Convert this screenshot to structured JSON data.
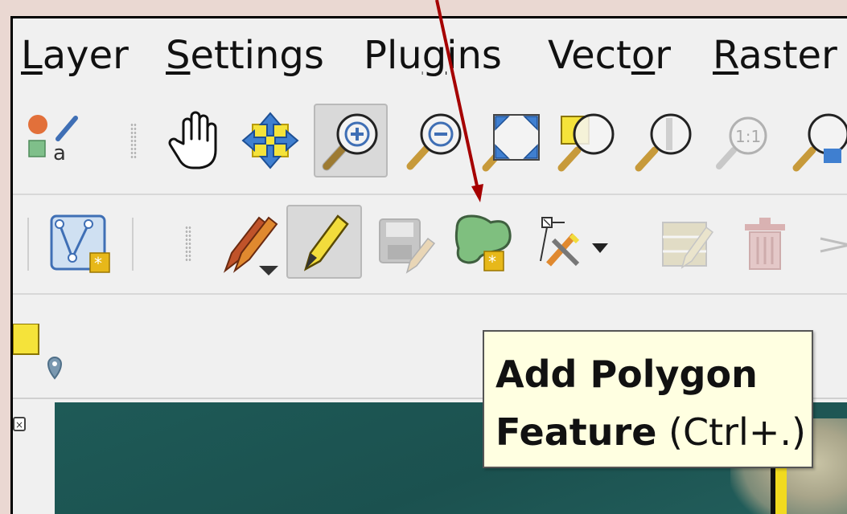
{
  "menubar": {
    "items": [
      {
        "mnemonic": "L",
        "rest": "ayer"
      },
      {
        "mnemonic": "S",
        "rest": "ettings"
      },
      {
        "pre": "Plu",
        "mnemonic": "g",
        "rest": "ins"
      },
      {
        "pre": "Vect",
        "mnemonic": "o",
        "rest": "r"
      },
      {
        "mnemonic": "R",
        "rest": "aster"
      }
    ]
  },
  "toolbar_map_nav": {
    "items": [
      {
        "icon": "layer-styling-icon",
        "label": "a"
      },
      {
        "icon": "pan-hand-icon"
      },
      {
        "icon": "pan-to-selection-icon"
      },
      {
        "icon": "zoom-in-icon",
        "active": true
      },
      {
        "icon": "zoom-out-icon"
      },
      {
        "icon": "zoom-full-icon"
      },
      {
        "icon": "zoom-to-selection-icon"
      },
      {
        "icon": "zoom-to-layer-icon"
      },
      {
        "icon": "zoom-native-resolution-icon",
        "label": "1:1"
      },
      {
        "icon": "zoom-last-icon"
      }
    ]
  },
  "toolbar_digitizing": {
    "items": [
      {
        "icon": "vertex-tool-icon"
      },
      {
        "icon": "current-edits-icon"
      },
      {
        "icon": "toggle-editing-icon",
        "active": true
      },
      {
        "icon": "save-edits-icon",
        "disabled": true
      },
      {
        "icon": "add-polygon-feature-icon"
      },
      {
        "icon": "digitize-with-segment-icon"
      },
      {
        "icon": "modify-attributes-icon",
        "disabled": true
      },
      {
        "icon": "delete-selected-icon",
        "disabled": true
      }
    ]
  },
  "tooltip": {
    "line1": "Add Polygon",
    "line2_bold": "Feature",
    "line2_rest": " (Ctrl+.)"
  },
  "colors": {
    "annotation_arrow": "#a50000",
    "tooltip_bg": "#ffffe1",
    "polygon_fill": "#7fbf7f",
    "map_water": "#1e5a57",
    "map_line": "#f1da1f"
  }
}
